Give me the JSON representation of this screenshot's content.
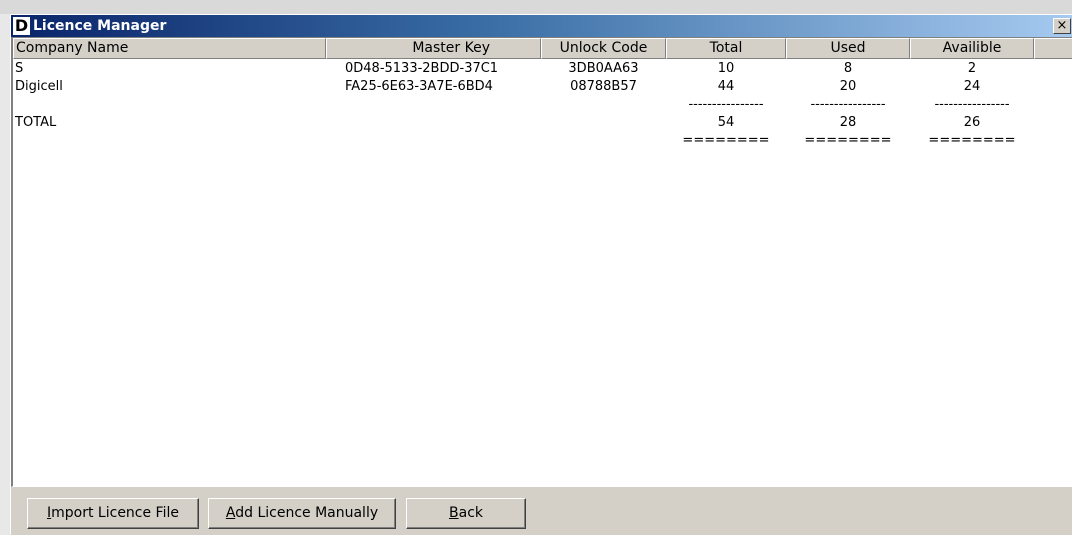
{
  "window": {
    "title": "Licence Manager",
    "icon_letter": "D",
    "close_glyph": "×"
  },
  "table": {
    "columns": [
      "Company Name",
      "Master Key",
      "Unlock Code",
      "Total",
      "Used",
      "Availible"
    ],
    "rows": [
      {
        "company": "S",
        "master_key": "0D48-5133-2BDD-37C1",
        "unlock_code": "3DB0AA63",
        "total": "10",
        "used": "8",
        "available": "2"
      },
      {
        "company": "Digicell",
        "master_key": "FA25-6E63-3A7E-6BD4",
        "unlock_code": "08788B57",
        "total": "44",
        "used": "20",
        "available": "24"
      }
    ],
    "separator": {
      "total": "----------------",
      "used": "----------------",
      "available": "----------------"
    },
    "total_row": {
      "label": "TOTAL",
      "total": "54",
      "used": "28",
      "available": "26"
    },
    "double_rule": {
      "total": "========",
      "used": "========",
      "available": "========"
    }
  },
  "buttons": {
    "import": {
      "mnemonic": "I",
      "rest": "mport Licence File"
    },
    "add": {
      "mnemonic": "A",
      "rest": "dd Licence Manually"
    },
    "back": {
      "mnemonic": "B",
      "rest": "ack"
    }
  },
  "colors": {
    "titlebar_start": "#0a246a",
    "titlebar_end": "#a6caf0",
    "face": "#d4d0c8"
  }
}
